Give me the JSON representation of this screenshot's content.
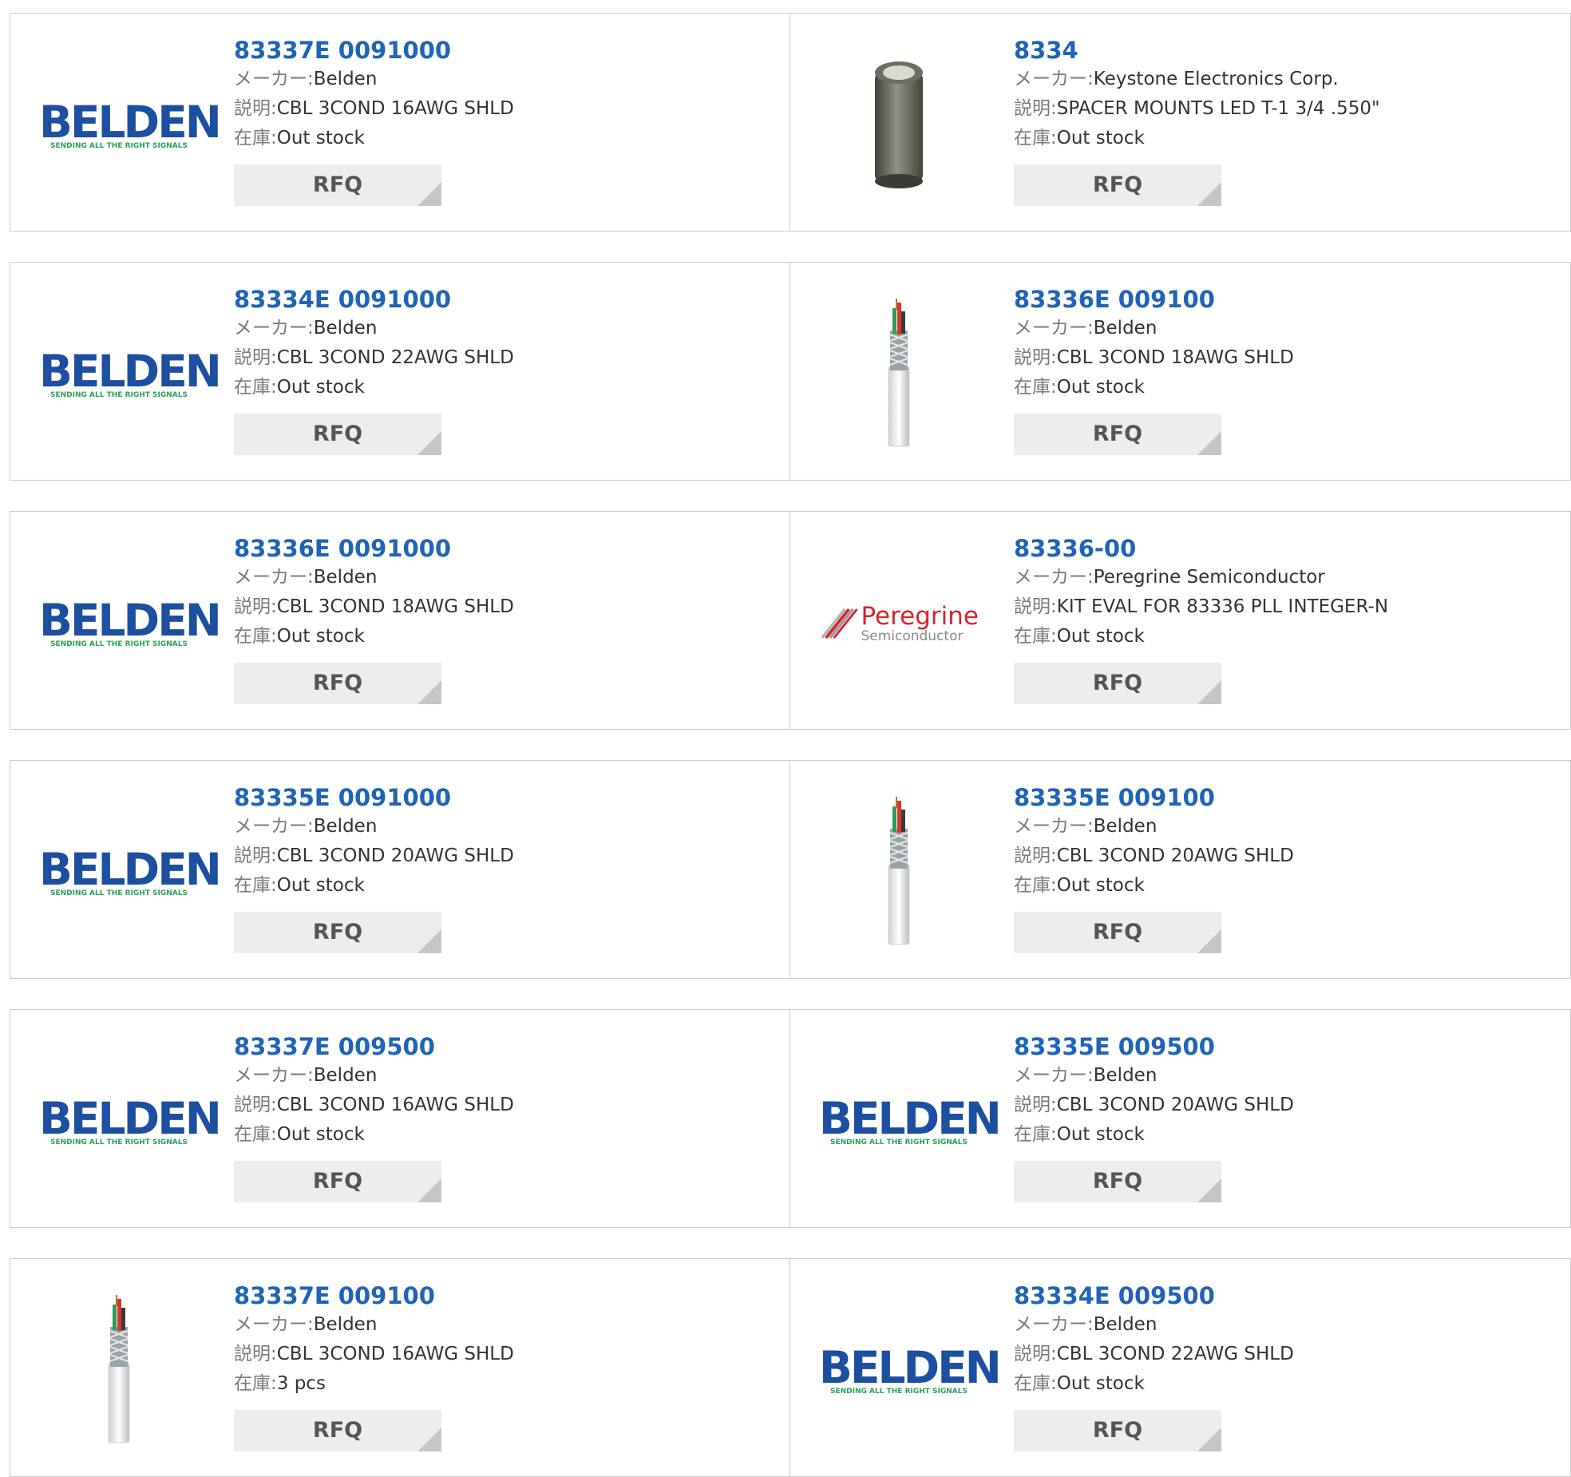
{
  "labels": {
    "maker": "メーカー:",
    "desc": "説明:",
    "stock": "在庫:",
    "rfq": "RFQ"
  },
  "logos": {
    "belden_word": "BELDEN",
    "belden_tag": "SENDING ALL THE RIGHT SIGNALS",
    "peregrine_word": "Peregrine",
    "peregrine_sub": "Semiconductor"
  },
  "colors": {
    "title_link": "#1f64b6",
    "belden_blue": "#1d4fa0",
    "belden_green": "#2aa05a",
    "peregrine_red": "#d6262c",
    "rfq_bg": "#ededed",
    "border": "#cccccc"
  },
  "products": [
    {
      "part": "83337E 0091000",
      "maker": "Belden",
      "desc": "CBL 3COND 16AWG SHLD",
      "stock": "Out stock",
      "image": "belden-logo"
    },
    {
      "part": "8334",
      "maker": "Keystone Electronics Corp.",
      "desc": "SPACER MOUNTS LED T-1 3/4 .550\"",
      "stock": "Out stock",
      "image": "spacer-tube"
    },
    {
      "part": "83334E 0091000",
      "maker": "Belden",
      "desc": "CBL 3COND 22AWG SHLD",
      "stock": "Out stock",
      "image": "belden-logo"
    },
    {
      "part": "83336E 009100",
      "maker": "Belden",
      "desc": "CBL 3COND 18AWG SHLD",
      "stock": "Out stock",
      "image": "cable"
    },
    {
      "part": "83336E 0091000",
      "maker": "Belden",
      "desc": "CBL 3COND 18AWG SHLD",
      "stock": "Out stock",
      "image": "belden-logo"
    },
    {
      "part": "83336-00",
      "maker": "Peregrine Semiconductor",
      "desc": "KIT EVAL FOR 83336 PLL INTEGER-N",
      "stock": "Out stock",
      "image": "peregrine-logo"
    },
    {
      "part": "83335E 0091000",
      "maker": "Belden",
      "desc": "CBL 3COND 20AWG SHLD",
      "stock": "Out stock",
      "image": "belden-logo"
    },
    {
      "part": "83335E 009100",
      "maker": "Belden",
      "desc": "CBL 3COND 20AWG SHLD",
      "stock": "Out stock",
      "image": "cable"
    },
    {
      "part": "83337E 009500",
      "maker": "Belden",
      "desc": "CBL 3COND 16AWG SHLD",
      "stock": "Out stock",
      "image": "belden-logo"
    },
    {
      "part": "83335E 009500",
      "maker": "Belden",
      "desc": "CBL 3COND 20AWG SHLD",
      "stock": "Out stock",
      "image": "belden-logo"
    },
    {
      "part": "83337E 009100",
      "maker": "Belden",
      "desc": "CBL 3COND 16AWG SHLD",
      "stock": "3 pcs",
      "image": "cable"
    },
    {
      "part": "83334E 009500",
      "maker": "Belden",
      "desc": "CBL 3COND 22AWG SHLD",
      "stock": "Out stock",
      "image": "belden-logo"
    }
  ]
}
